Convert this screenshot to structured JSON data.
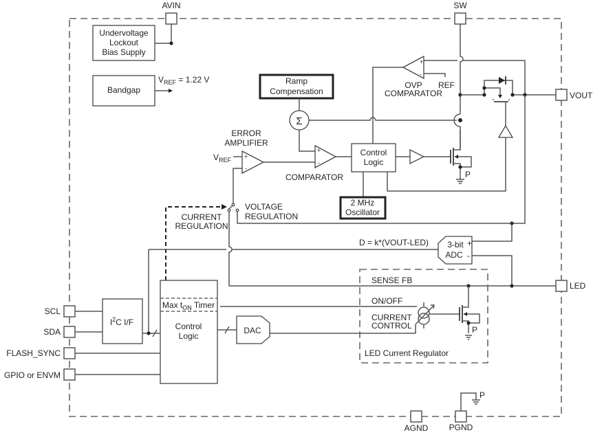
{
  "pins": {
    "avin": "AVIN",
    "sw": "SW",
    "vout": "VOUT",
    "led": "LED",
    "scl": "SCL",
    "sda": "SDA",
    "flash_sync": "FLASH_SYNC",
    "gpio": "GPIO or ENVM",
    "agnd": "AGND",
    "pgnd": "PGND"
  },
  "blocks": {
    "uvlo": [
      "Undervoltage",
      "Lockout",
      "Bias Supply"
    ],
    "bandgap": "Bandgap",
    "vref_label_main": "V",
    "vref_label_sub": "REF",
    "vref_value": " = 1.22 V",
    "ramp": [
      "Ramp",
      "Compensation"
    ],
    "sigma": "Σ",
    "error_amp": [
      "ERROR",
      "AMPLIFIER"
    ],
    "vref_in_main": "V",
    "vref_in_sub": "REF",
    "comparator": "COMPARATOR",
    "control_logic_top": [
      "Control",
      "Logic"
    ],
    "ovp": [
      "OVP",
      "COMPARATOR"
    ],
    "ref": "REF",
    "oscillator": [
      "2 MHz",
      "Oscillator"
    ],
    "current_reg": [
      "CURRENT",
      "REGULATION"
    ],
    "voltage_reg": [
      "VOLTAGE",
      "REGULATION"
    ],
    "adc_eq": "D = k*(VOUT-LED)",
    "adc": [
      "3-bit",
      "ADC"
    ],
    "adc_plus": "+",
    "adc_minus": "-",
    "sense_fb": "SENSE FB",
    "on_off": "ON/OFF",
    "current_control": [
      "CURRENT",
      "CONTROL"
    ],
    "led_regulator": "LED Current Regulator",
    "i2c_main": "I",
    "i2c_sup": "2",
    "i2c_rest": "C I/F",
    "timer_main": "Max t",
    "timer_sub": "ON",
    "timer_rest": " Timer",
    "control_logic_bottom": [
      "Control",
      "Logic"
    ],
    "dac": "DAC",
    "p_label": "P",
    "plus": "+",
    "minus": "-"
  }
}
